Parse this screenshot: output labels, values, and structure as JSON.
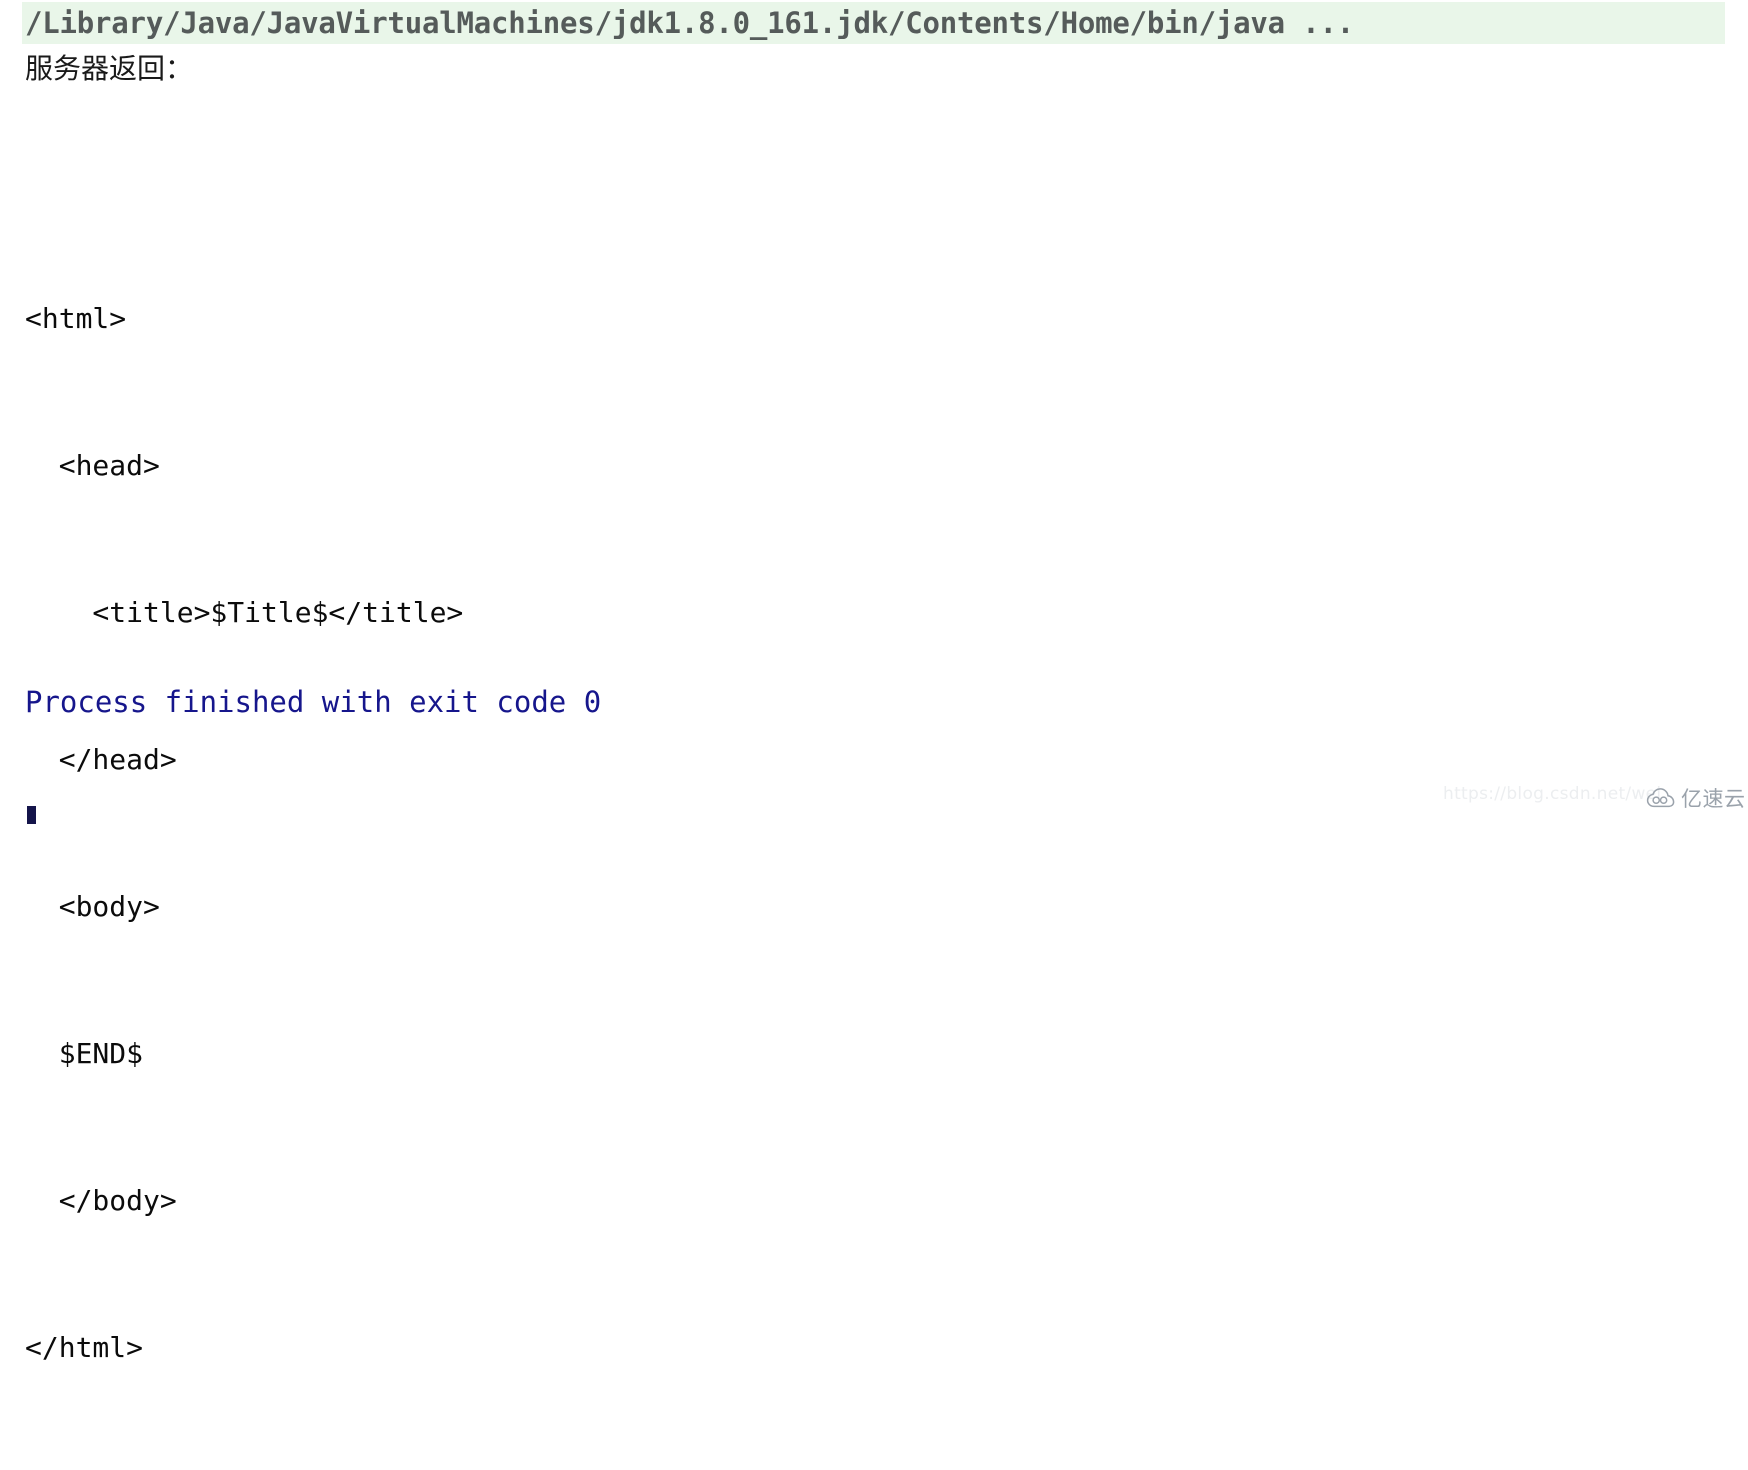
{
  "console": {
    "command_line": "/Library/Java/JavaVirtualMachines/jdk1.8.0_161.jdk/Contents/Home/bin/java ...",
    "command_line_highlight_color": "#e9f6e9",
    "command_line_text_color": "#555b5a",
    "server_label": "服务器返回：",
    "output_lines": [
      "<html>",
      "  <head>",
      "    <title>$Title$</title>",
      "  </head>",
      "  <body>",
      "  $END$",
      "  </body>",
      "</html>"
    ],
    "exit_message": "Process finished with exit code 0",
    "exit_message_color": "#16168c"
  },
  "watermarks": {
    "url": "https://blog.csdn.net/wei",
    "brand": "亿速云",
    "logo_icon": "cloud-icon",
    "color": "#9aa2ab"
  }
}
